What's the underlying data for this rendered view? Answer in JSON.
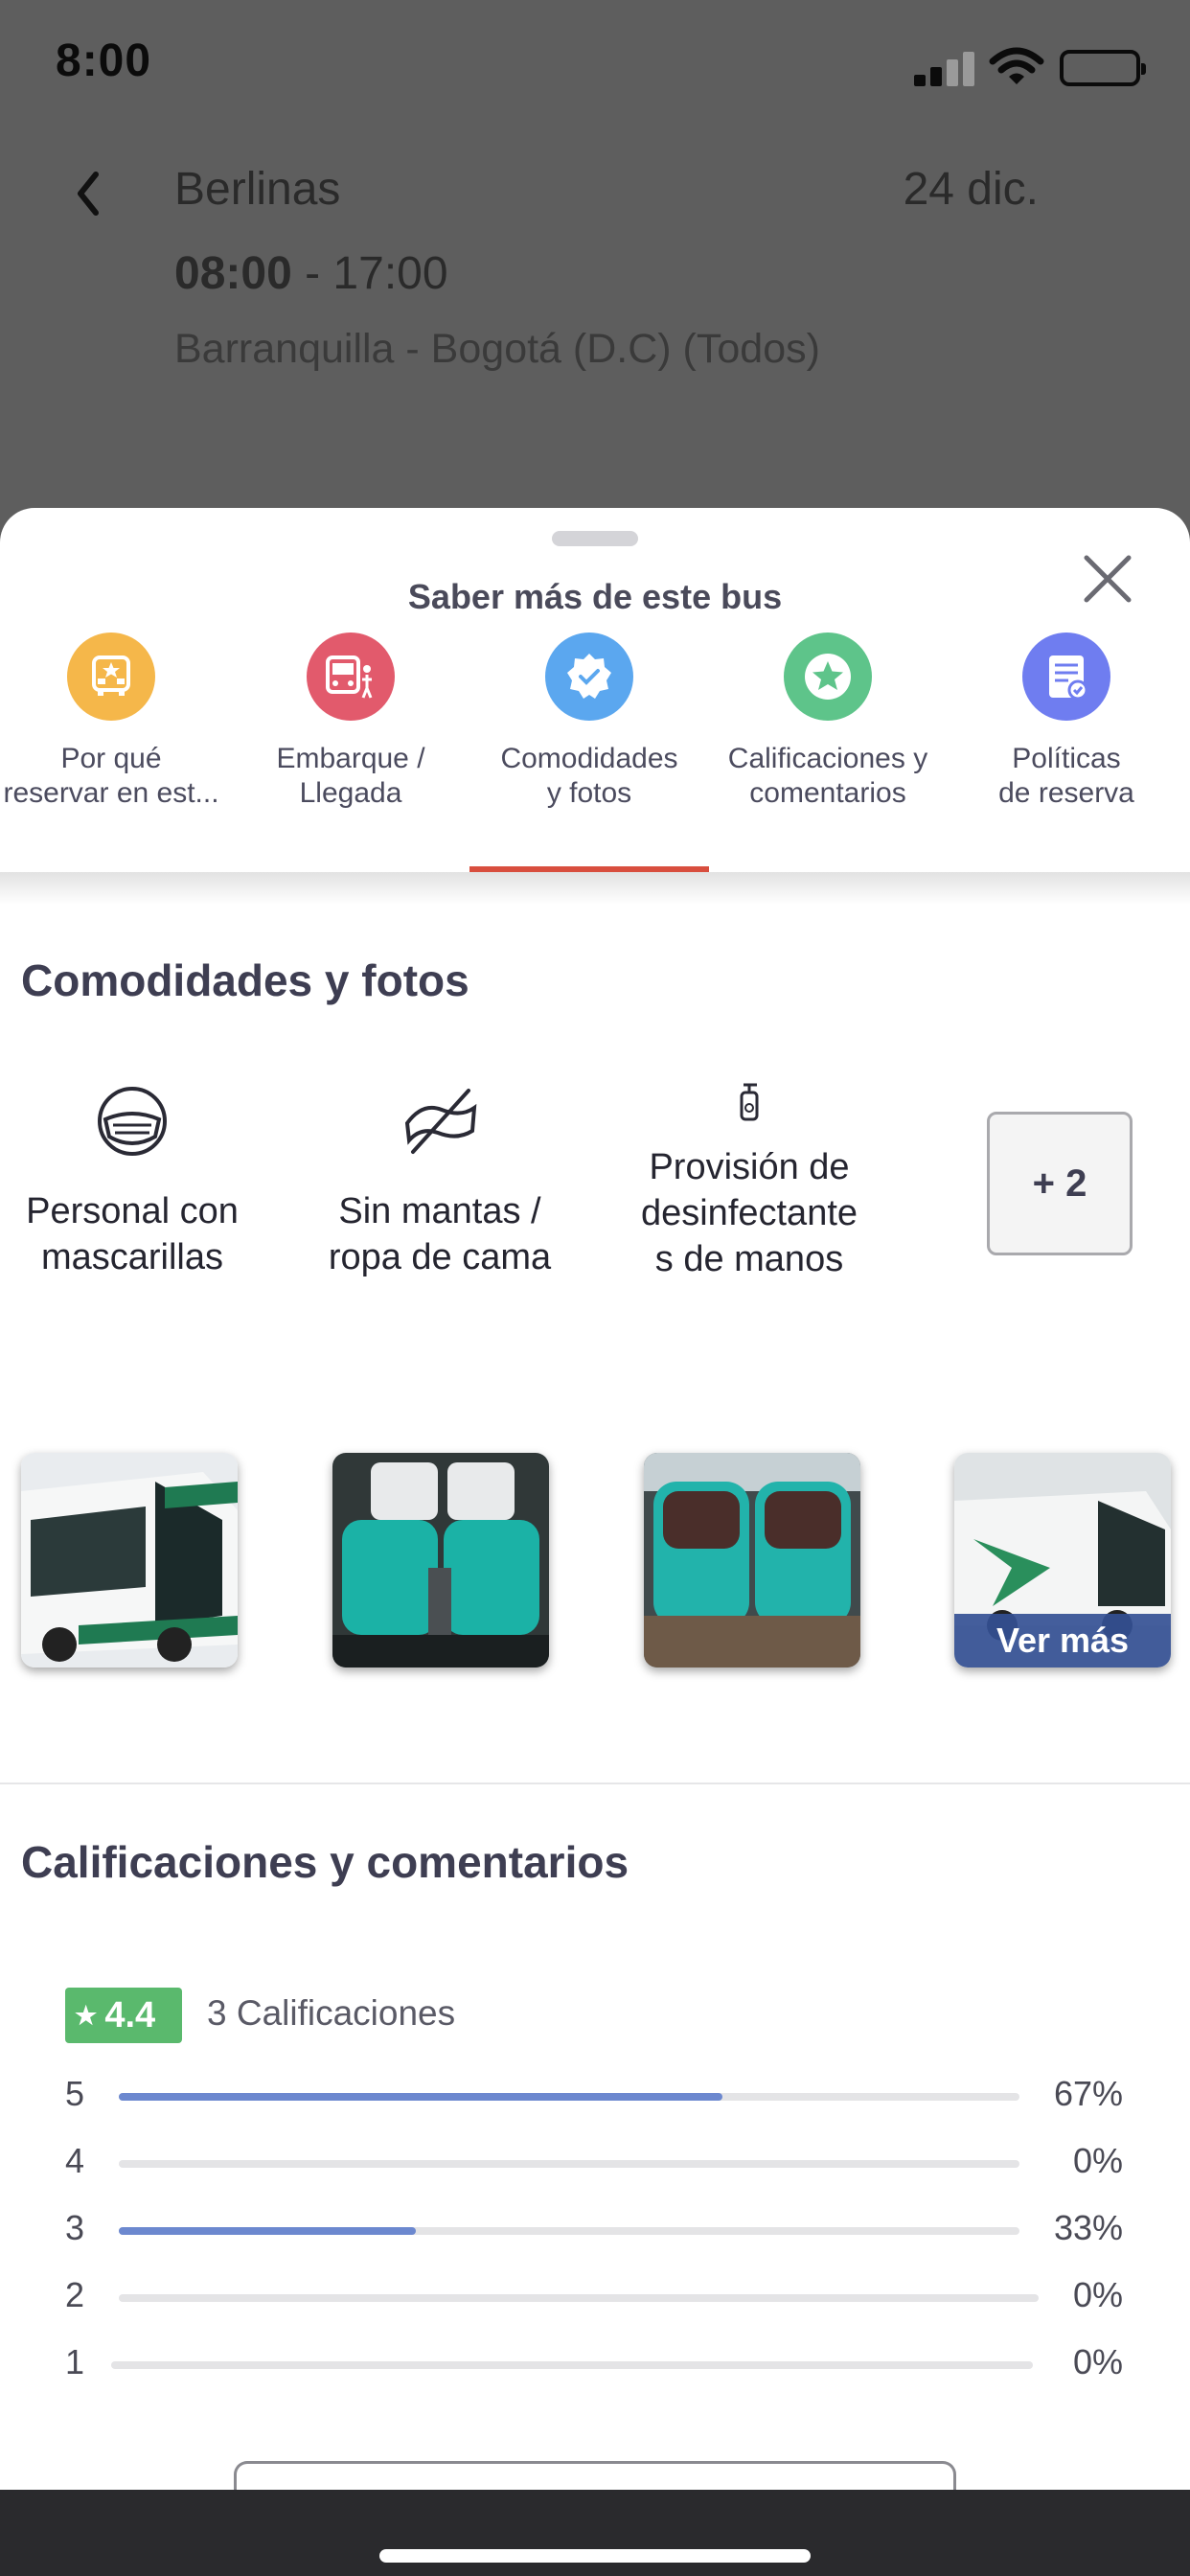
{
  "status_bar": {
    "time": "8:00"
  },
  "header": {
    "operator": "Berlinas",
    "date": "24 dic.",
    "departure": "08:00",
    "arrival_sep": " - 17:00",
    "route": "Barranquilla - Bogotá (D.C) (Todos)"
  },
  "sheet": {
    "title": "Saber más de este bus",
    "tabs": [
      {
        "label": "Por qué\nreservar en est...",
        "icon": "bus-star-icon",
        "color": "#f5b74a"
      },
      {
        "label": "Embarque /\nLlegada",
        "icon": "bus-person-icon",
        "color": "#e25a6c"
      },
      {
        "label": "Comodidades\ny fotos",
        "icon": "badge-check-icon",
        "color": "#5ba7ef"
      },
      {
        "label": "Calificaciones y\ncomentarios",
        "icon": "star-icon",
        "color": "#5ec48a"
      },
      {
        "label": "Políticas\nde reserva",
        "icon": "document-check-icon",
        "color": "#6f7df0"
      }
    ],
    "active_tab_index": 2,
    "active_tab_color": "#d84e3e"
  },
  "amenities": {
    "title": "Comodidades y fotos",
    "items": [
      {
        "label": "Personal con\nmascarillas",
        "icon": "face-mask-icon"
      },
      {
        "label": "Sin mantas /\nropa de cama",
        "icon": "no-blanket-icon"
      },
      {
        "label": "Provisión de\ndesinfectante\ns de manos",
        "icon": "sanitizer-icon"
      }
    ],
    "more_label": "+ 2",
    "photos_more_label": "Ver más"
  },
  "ratings": {
    "title": "Calificaciones y comentarios",
    "score": "4.4",
    "count_label": "3 Calificaciones",
    "bars": [
      {
        "stars": "5",
        "percent_label": "67%",
        "fraction": 0.67
      },
      {
        "stars": "4",
        "percent_label": "0%",
        "fraction": 0
      },
      {
        "stars": "3",
        "percent_label": "33%",
        "fraction": 0.33
      },
      {
        "stars": "2",
        "percent_label": "0%",
        "fraction": 0
      },
      {
        "stars": "1",
        "percent_label": "0%",
        "fraction": 0
      }
    ]
  }
}
